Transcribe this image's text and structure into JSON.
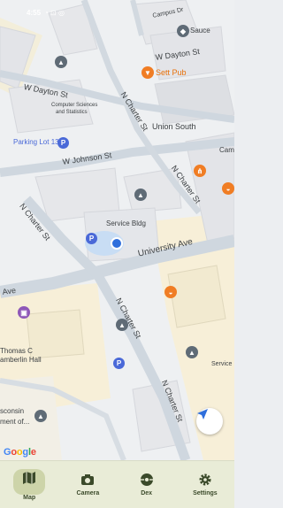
{
  "status_bar": {
    "time": "4:55",
    "indicators": "◔ ⊡ ◎"
  },
  "map": {
    "streets": {
      "w_dayton_top": "W Dayton St",
      "w_dayton_mid": "W Dayton St",
      "w_johnson": "W Johnson St",
      "n_charter_left": "N Charter St",
      "n_charter_bottom": "N Charter St",
      "n_charter_right": "N Charter St",
      "n_charter_upper": "N Charter St",
      "university_ave": "University Ave",
      "university_ave_left": "Ave",
      "n_charter_top": "N Charter St",
      "campus_top": "Campus Dr"
    },
    "places": {
      "sauce": "Sauce",
      "sett_pub": "Sett Pub",
      "union_south": "Union South",
      "computer_sciences": "Computer Sciences",
      "computer_sciences_2": "and Statistics",
      "parking_lot": "Parking Lot 13",
      "service_bldg": "Service Bldg",
      "thomas_c_1": "Thomas C",
      "thomas_c_2": "amberlin Hall",
      "wisconsin_1": "sconsin",
      "wisconsin_2": "ment of...",
      "service_right": "Service",
      "cam_right": "Cam"
    },
    "attribution": "Google",
    "colors": {
      "block": "#f2f0e4",
      "road": "#cfd7df",
      "building": "#e6e7ea",
      "campus": "#f7efd8"
    }
  },
  "nav": {
    "items": [
      {
        "label": "Map",
        "icon": "map-icon"
      },
      {
        "label": "Camera",
        "icon": "camera-icon"
      },
      {
        "label": "Dex",
        "icon": "dex-icon"
      },
      {
        "label": "Settings",
        "icon": "settings-icon"
      }
    ]
  }
}
